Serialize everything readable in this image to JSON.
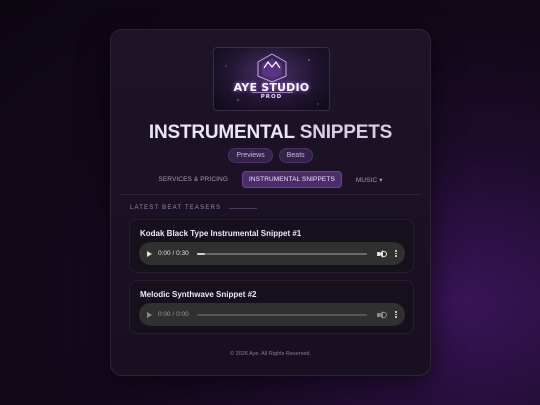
{
  "brand": {
    "logo_line1": "AYE STUDIO",
    "logo_line2": "PROD"
  },
  "page": {
    "title_part1": "INSTRUMENTAL",
    "title_part2": "SNIPPETS"
  },
  "tags": [
    "Previews",
    "Beats"
  ],
  "nav": {
    "items": [
      {
        "label": "SERVICES & PRICING",
        "active": false
      },
      {
        "label": "INSTRUMENTAL SNIPPETS",
        "active": true
      },
      {
        "label": "MUSIC ▾",
        "active": false
      }
    ]
  },
  "section": {
    "heading": "LATEST BEAT TEASERS"
  },
  "snippets": [
    {
      "title": "Kodak Black Type Instrumental Snippet #1",
      "time": "0:00 / 0:30",
      "progress": 0.05,
      "loaded": true
    },
    {
      "title": "Melodic Synthwave Snippet #2",
      "time": "0:00 / 0:00",
      "progress": 0,
      "loaded": false
    }
  ],
  "footer": {
    "text": "© 2026 Aye. All Rights Reserved."
  },
  "colors": {
    "accent": "#4b2d6a",
    "tag_bg": "#34224a",
    "card_bg": "#1e1428"
  }
}
